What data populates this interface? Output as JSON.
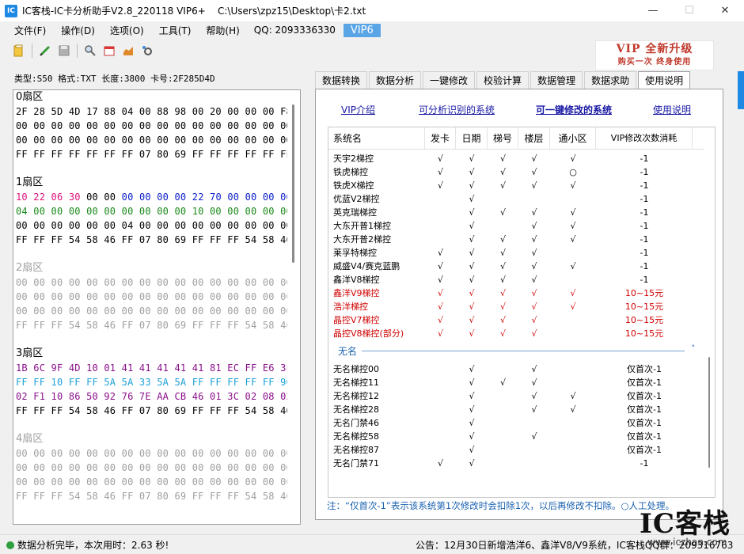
{
  "window": {
    "title": "IC客栈-IC卡分析助手V2.8_220118 VIP6+    C:\\Users\\zpz15\\Desktop\\卡2.txt",
    "app_icon": "IC",
    "minimize": "—",
    "maximize": "☐",
    "close": "✕"
  },
  "menu": {
    "items": [
      "文件(F)",
      "操作(D)",
      "选项(O)",
      "工具(T)",
      "帮助(H)"
    ],
    "qq": "QQ:  2093336330",
    "vip": "VIP6"
  },
  "toolbar": {
    "icons": [
      "open-folder-icon",
      "edit-pencil-icon",
      "save-icon",
      "search-icon",
      "calendar-icon",
      "chart-icon",
      "settings-icon"
    ]
  },
  "banner": {
    "line1": "VIP 全新升级",
    "line2": "购买一次   终身使用"
  },
  "card_info": "类型:S50 格式:TXT 长度:3800 卡号:2F285D4D",
  "sectors": [
    {
      "title": "0扇区",
      "grey": false,
      "lines": [
        {
          "text": "2F 28 5D 4D 17 88 04 00 88 98 00 20 00 00 00 F8",
          "color": "#000000"
        },
        {
          "text": "00 00 00 00 00 00 00 00 00 00 00 00 00 00 00 00",
          "color": "#000000"
        },
        {
          "text": "00 00 00 00 00 00 00 00 00 00 00 00 00 00 00 00",
          "color": "#000000"
        },
        {
          "text": "FF FF FF FF FF FF FF 07 80 69 FF FF FF FF FF FF",
          "color": "#000000"
        }
      ]
    },
    {
      "title": "1扇区",
      "grey": false,
      "lines": [
        {
          "segments": [
            {
              "text": "10 22 06 30 ",
              "color": "#e0107a"
            },
            {
              "text": "00 00 ",
              "color": "#000000"
            },
            {
              "text": "00 00 00 00 22 70 00 00 00 00",
              "color": "#0a1ec8"
            }
          ]
        },
        {
          "text": "04 00 00 00 00 00 00 00 00 00 10 00 00 00 00 00",
          "color": "#1a8a1a"
        },
        {
          "text": "00 00 00 00 00 00 04 00 00 00 00 00 00 00 00 00",
          "color": "#000000"
        },
        {
          "text": "FF FF FF 54 58 46 FF 07 80 69 FF FF FF 54 58 46",
          "color": "#000000"
        }
      ]
    },
    {
      "title": "2扇区",
      "grey": true,
      "lines": [
        {
          "text": "00 00 00 00 00 00 00 00 00 00 00 00 00 00 00 00",
          "color": "#a0a0a0"
        },
        {
          "text": "00 00 00 00 00 00 00 00 00 00 00 00 00 00 00 00",
          "color": "#a0a0a0"
        },
        {
          "text": "00 00 00 00 00 00 00 00 00 00 00 00 00 00 00 00",
          "color": "#a0a0a0"
        },
        {
          "text": "FF FF FF 54 58 46 FF 07 80 69 FF FF FF 54 58 46",
          "color": "#a0a0a0"
        }
      ]
    },
    {
      "title": "3扇区",
      "grey": false,
      "lines": [
        {
          "text": "1B 6C 9F 4D 10 01 41 41 41 41 41 81 EC FF E6 3F",
          "color": "#8a108a"
        },
        {
          "text": "FF FF 10 FF FF 5A 5A 33 5A 5A FF FF FF FF FF 96",
          "color": "#1ea0d8"
        },
        {
          "text": "02 F1 10 86 50 92 76 7E AA CB 46 01 3C 02 08 02",
          "color": "#8a108a"
        },
        {
          "text": "FF FF FF 54 58 46 FF 07 80 69 FF FF FF 54 58 46",
          "color": "#000000"
        }
      ]
    },
    {
      "title": "4扇区",
      "grey": true,
      "lines": [
        {
          "text": "00 00 00 00 00 00 00 00 00 00 00 00 00 00 00 00",
          "color": "#a0a0a0"
        },
        {
          "text": "00 00 00 00 00 00 00 00 00 00 00 00 00 00 00 00",
          "color": "#a0a0a0"
        },
        {
          "text": "00 00 00 00 00 00 00 00 00 00 00 00 00 00 00 00",
          "color": "#a0a0a0"
        },
        {
          "text": "FF FF FF 54 58 46 FF 07 80 69 FF FF FF 54 58 46",
          "color": "#a0a0a0"
        }
      ]
    }
  ],
  "tabs": [
    "数据转换",
    "数据分析",
    "一键修改",
    "校验计算",
    "数据管理",
    "数据求助",
    "使用说明"
  ],
  "active_tab": 6,
  "links": [
    "VIP介绍",
    "可分析识别的系统",
    "可一键修改的系统",
    "使用说明"
  ],
  "table": {
    "headers": [
      "系统名",
      "发卡",
      "日期",
      "梯号",
      "楼层",
      "通小区",
      "VIP修改次数消耗"
    ],
    "rows": [
      {
        "name": "天宇2梯控",
        "fk": "√",
        "rq": "√",
        "th": "√",
        "lc": "√",
        "xq": "√",
        "vip": "-1",
        "red": false
      },
      {
        "name": "铁虎梯控",
        "fk": "√",
        "rq": "√",
        "th": "√",
        "lc": "√",
        "xq": "○",
        "vip": "-1",
        "red": false
      },
      {
        "name": "铁虎X梯控",
        "fk": "√",
        "rq": "√",
        "th": "√",
        "lc": "√",
        "xq": "√",
        "vip": "-1",
        "red": false
      },
      {
        "name": "优蓝V2梯控",
        "fk": "",
        "rq": "√",
        "th": "",
        "lc": "",
        "xq": "",
        "vip": "-1",
        "red": false
      },
      {
        "name": "英克瑞梯控",
        "fk": "",
        "rq": "√",
        "th": "√",
        "lc": "√",
        "xq": "√",
        "vip": "-1",
        "red": false
      },
      {
        "name": "大东开普1梯控",
        "fk": "",
        "rq": "√",
        "th": "",
        "lc": "√",
        "xq": "√",
        "vip": "-1",
        "red": false
      },
      {
        "name": "大东开普2梯控",
        "fk": "",
        "rq": "√",
        "th": "√",
        "lc": "√",
        "xq": "√",
        "vip": "-1",
        "red": false
      },
      {
        "name": "莱孚特梯控",
        "fk": "√",
        "rq": "√",
        "th": "√",
        "lc": "√",
        "xq": "",
        "vip": "-1",
        "red": false
      },
      {
        "name": "威盛V4/赛克蓝鹏",
        "fk": "√",
        "rq": "√",
        "th": "√",
        "lc": "√",
        "xq": "√",
        "vip": "-1",
        "red": false
      },
      {
        "name": "鑫洋V8梯控",
        "fk": "√",
        "rq": "√",
        "th": "√",
        "lc": "√",
        "xq": "",
        "vip": "-1",
        "red": false
      },
      {
        "name": "鑫洋V9梯控",
        "fk": "√",
        "rq": "√",
        "th": "√",
        "lc": "√",
        "xq": "√",
        "vip": "10~15元",
        "red": true
      },
      {
        "name": "浩洋梯控",
        "fk": "√",
        "rq": "√",
        "th": "√",
        "lc": "√",
        "xq": "√",
        "vip": "10~15元",
        "red": true
      },
      {
        "name": "晶控V7梯控",
        "fk": "√",
        "rq": "√",
        "th": "√",
        "lc": "√",
        "xq": "",
        "vip": "10~15元",
        "red": true
      },
      {
        "name": "晶控V8梯控(部分)",
        "fk": "√",
        "rq": "√",
        "th": "√",
        "lc": "√",
        "xq": "",
        "vip": "10~15元",
        "red": true
      }
    ],
    "group_label": "无名",
    "group_caret": "˄",
    "group_rows": [
      {
        "name": "无名梯控00",
        "fk": "",
        "rq": "√",
        "th": "",
        "lc": "√",
        "xq": "",
        "vip": "仅首次-1"
      },
      {
        "name": "无名梯控11",
        "fk": "",
        "rq": "√",
        "th": "√",
        "lc": "√",
        "xq": "",
        "vip": "仅首次-1"
      },
      {
        "name": "无名梯控12",
        "fk": "",
        "rq": "√",
        "th": "",
        "lc": "√",
        "xq": "√",
        "vip": "仅首次-1"
      },
      {
        "name": "无名梯控28",
        "fk": "",
        "rq": "√",
        "th": "",
        "lc": "√",
        "xq": "√",
        "vip": "仅首次-1"
      },
      {
        "name": "无名门禁46",
        "fk": "",
        "rq": "√",
        "th": "",
        "lc": "",
        "xq": "",
        "vip": "仅首次-1"
      },
      {
        "name": "无名梯控58",
        "fk": "",
        "rq": "√",
        "th": "",
        "lc": "√",
        "xq": "",
        "vip": "仅首次-1"
      },
      {
        "name": "无名梯控87",
        "fk": "",
        "rq": "√",
        "th": "",
        "lc": "",
        "xq": "",
        "vip": "仅首次-1"
      },
      {
        "name": "无名门禁71",
        "fk": "√",
        "rq": "√",
        "th": "",
        "lc": "",
        "xq": "",
        "vip": "-1"
      }
    ]
  },
  "note": "注：“仅首次-1”表示该系统第1次修改时会扣除1次，以后再修改不扣除。○人工处理。",
  "status": {
    "left": "数据分析完毕，本次用时：2.63 秒!",
    "right": "公告：12月30日新增浩洋6、鑫洋V8/V9系统，IC客栈QQ群：209316763"
  },
  "watermark": {
    "logo": "IC客栈",
    "url": "www.iczhan.com"
  }
}
